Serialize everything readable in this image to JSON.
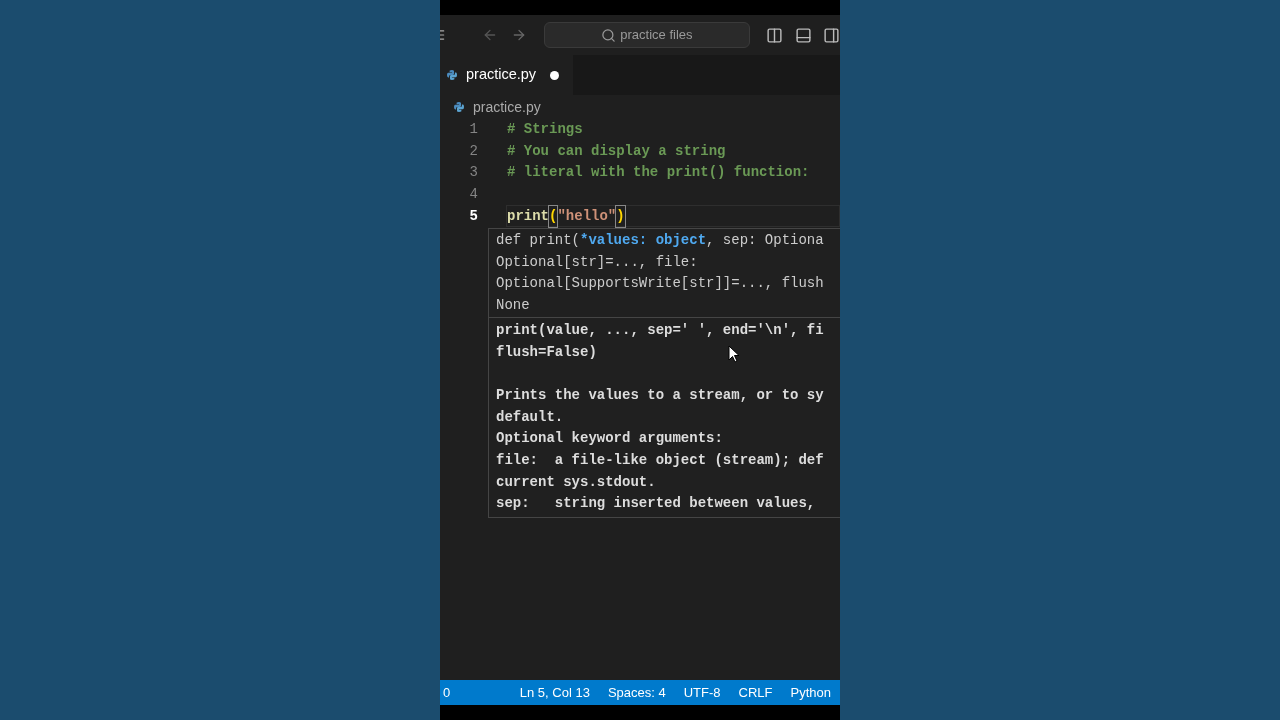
{
  "title_bar": {
    "search": "practice files"
  },
  "tabs": [
    {
      "label": "practice.py",
      "selected": true,
      "modified": true
    }
  ],
  "breadcrumb": "practice.py",
  "editor": {
    "lines": [
      {
        "number": "1",
        "current": false,
        "tokens": [
          {
            "text": "# Strings",
            "kind": "comment"
          }
        ]
      },
      {
        "number": "2",
        "current": false,
        "tokens": [
          {
            "text": "# You can display a string",
            "kind": "comment"
          }
        ]
      },
      {
        "number": "3",
        "current": false,
        "tokens": [
          {
            "text": "# literal with the print() function:",
            "kind": "comment"
          }
        ]
      },
      {
        "number": "4",
        "current": false
      },
      {
        "number": "5",
        "current": true,
        "tokens": [
          {
            "text": "print",
            "kind": "function"
          },
          {
            "text": "(",
            "kind": "bracket"
          },
          {
            "text": "\"hello\"",
            "kind": "string"
          },
          {
            "text": ")",
            "kind": "bracket"
          }
        ]
      }
    ]
  },
  "hover": {
    "signature": [
      [
        {
          "text": "def print(",
          "kind": "plain"
        },
        {
          "text": "*values: object",
          "kind": "param"
        },
        {
          "text": ", sep: Optiona",
          "kind": "plain"
        }
      ],
      [
        {
          "text": "Optional[str]=..., file:",
          "kind": "plain"
        }
      ],
      [
        {
          "text": "Optional[SupportsWrite[str]]=..., flush",
          "kind": "plain"
        }
      ],
      [
        {
          "text": "None",
          "kind": "plain"
        }
      ]
    ],
    "doc_paragraphs": [
      [
        "print(value, ..., sep=' ', end='\\n', fi",
        "flush=False)"
      ],
      [
        "Prints the values to a stream, or to sy",
        "default.",
        "Optional keyword arguments:",
        "file:  a file-like object (stream); def",
        "current sys.stdout.",
        "sep:   string inserted between values,"
      ]
    ]
  },
  "status_bar": {
    "items": [
      "0",
      "Ln 5, Col 13",
      "Spaces: 4",
      "UTF-8",
      "CRLF",
      "Python"
    ]
  }
}
